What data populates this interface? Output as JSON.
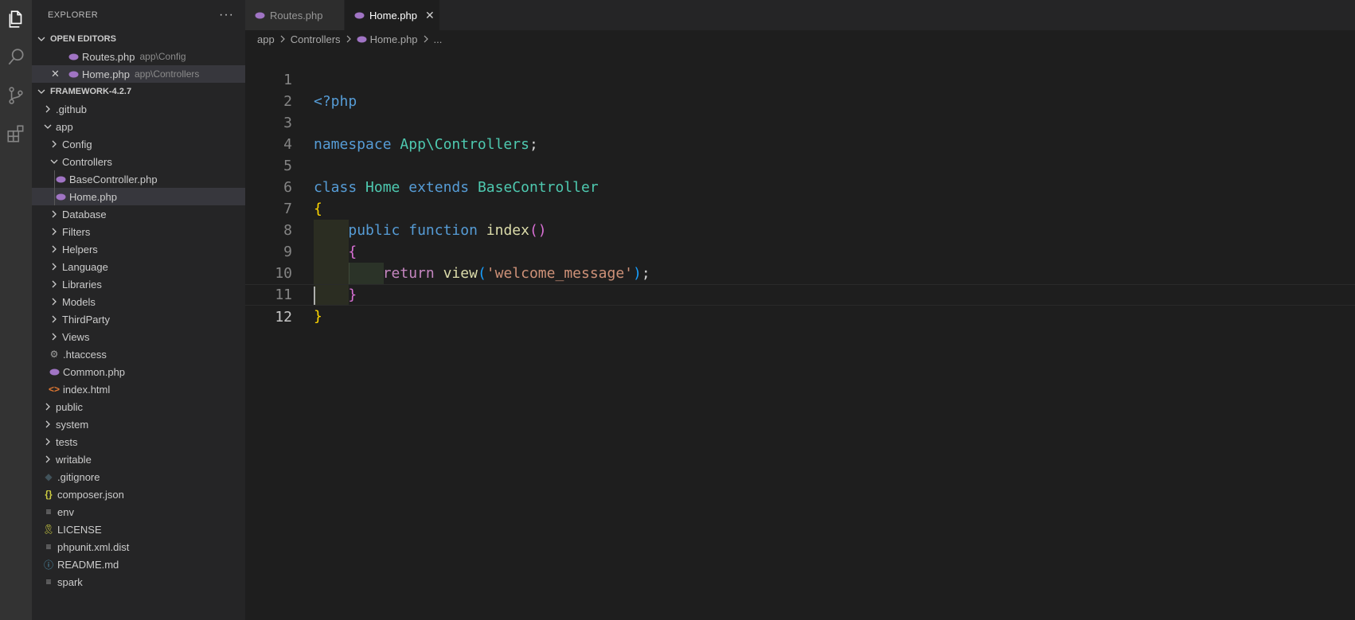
{
  "sidebar": {
    "title": "EXPLORER",
    "more": "···",
    "open_editors": {
      "label": "OPEN EDITORS",
      "items": [
        {
          "name": "Routes.php",
          "path": "app\\Config"
        },
        {
          "name": "Home.php",
          "path": "app\\Controllers"
        }
      ]
    },
    "project": {
      "label": "FRAMEWORK-4.2.7",
      "tree": [
        {
          "label": ".github"
        },
        {
          "label": "app"
        },
        {
          "label": "Config"
        },
        {
          "label": "Controllers"
        },
        {
          "label": "BaseController.php"
        },
        {
          "label": "Home.php"
        },
        {
          "label": "Database"
        },
        {
          "label": "Filters"
        },
        {
          "label": "Helpers"
        },
        {
          "label": "Language"
        },
        {
          "label": "Libraries"
        },
        {
          "label": "Models"
        },
        {
          "label": "ThirdParty"
        },
        {
          "label": "Views"
        },
        {
          "label": ".htaccess"
        },
        {
          "label": "Common.php"
        },
        {
          "label": "index.html"
        },
        {
          "label": "public"
        },
        {
          "label": "system"
        },
        {
          "label": "tests"
        },
        {
          "label": "writable"
        },
        {
          "label": ".gitignore"
        },
        {
          "label": "composer.json"
        },
        {
          "label": "env"
        },
        {
          "label": "LICENSE"
        },
        {
          "label": "phpunit.xml.dist"
        },
        {
          "label": "README.md"
        },
        {
          "label": "spark"
        }
      ]
    }
  },
  "tabs": [
    {
      "label": "Routes.php"
    },
    {
      "label": "Home.php",
      "close": "✕"
    }
  ],
  "breadcrumbs": [
    "app",
    "Controllers",
    "Home.php",
    "..."
  ],
  "code": {
    "line_numbers": [
      "1",
      "2",
      "3",
      "4",
      "5",
      "6",
      "7",
      "8",
      "9",
      "10",
      "11",
      "12"
    ],
    "l1": "<?php",
    "l3_kw": "namespace",
    "l3_ns": "App\\Controllers",
    "l3_semi": ";",
    "l5_class": "class",
    "l5_name": "Home",
    "l5_extends": "extends",
    "l5_base": "BaseController",
    "l6": "{",
    "l7_public": "public",
    "l7_function": "function",
    "l7_name": "index",
    "l7_parens": "()",
    "l8": "{",
    "l9_return": "return",
    "l9_fn": "view",
    "l9_open": "(",
    "l9_str": "'welcome_message'",
    "l9_close": ")",
    "l9_semi": ";",
    "l10": "}",
    "l11": "}"
  },
  "colors": {
    "php_icon": "#a074c4",
    "html_icon": "#e37933",
    "json_icon": "#cbcb41",
    "info_icon": "#519aba"
  }
}
